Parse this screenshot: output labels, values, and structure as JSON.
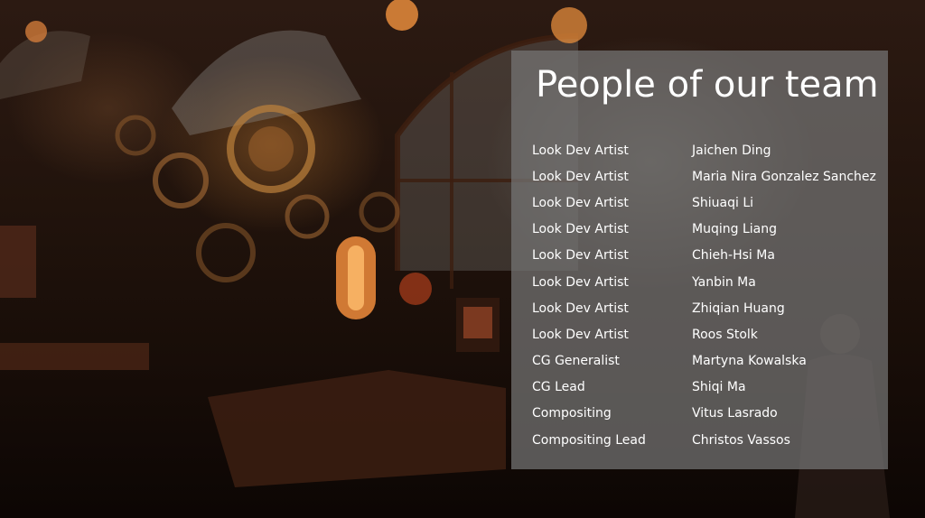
{
  "slide": {
    "title": "People of our team",
    "colors": {
      "panel": "#767676",
      "text": "#ffffff",
      "background": "#21130c"
    },
    "members": [
      {
        "role": "Look Dev Artist",
        "name": "Jaichen Ding"
      },
      {
        "role": "Look Dev Artist",
        "name": "Maria Nira Gonzalez Sanchez"
      },
      {
        "role": "Look Dev Artist",
        "name": "Shiuaqi Li"
      },
      {
        "role": "Look Dev Artist",
        "name": "Muqing Liang"
      },
      {
        "role": "Look Dev Artist",
        "name": "Chieh-Hsi Ma"
      },
      {
        "role": "Look Dev Artist",
        "name": "Yanbin Ma"
      },
      {
        "role": "Look Dev Artist",
        "name": "Zhiqian Huang"
      },
      {
        "role": "Look Dev Artist",
        "name": "Roos Stolk"
      },
      {
        "role": "CG Generalist",
        "name": "Martyna Kowalska"
      },
      {
        "role": "CG Lead",
        "name": "Shiqi Ma"
      },
      {
        "role": "Compositing",
        "name": "Vitus Lasrado"
      },
      {
        "role": "Compositing Lead",
        "name": "Christos Vassos"
      }
    ]
  }
}
